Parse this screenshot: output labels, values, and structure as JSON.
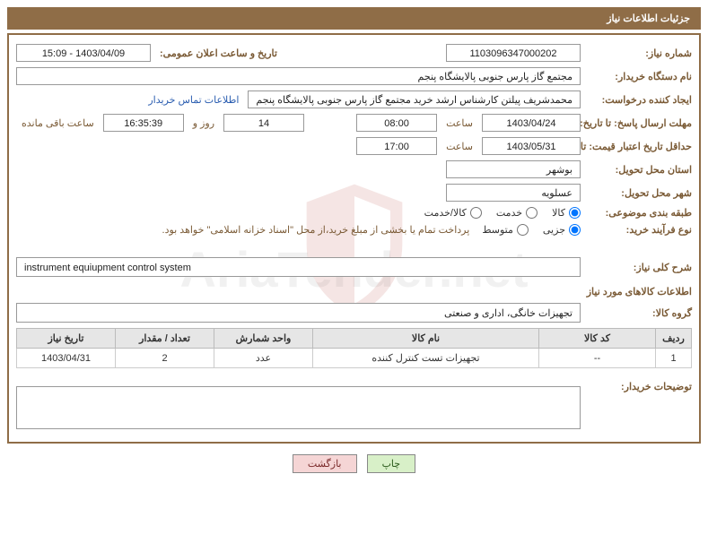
{
  "header": {
    "title": "جزئیات اطلاعات نیاز"
  },
  "labels": {
    "need_no": "شماره نیاز:",
    "announce_datetime": "تاریخ و ساعت اعلان عمومی:",
    "buyer_org": "نام دستگاه خریدار:",
    "requester": "ایجاد کننده درخواست:",
    "buyer_contact": "اطلاعات تماس خریدار",
    "response_deadline": "مهلت ارسال پاسخ: تا تاریخ:",
    "time_word": "ساعت",
    "days_word": "روز و",
    "remaining": "ساعت باقی مانده",
    "validity_deadline": "حداقل تاریخ اعتبار قیمت: تا تاریخ:",
    "delivery_province": "استان محل تحویل:",
    "delivery_city": "شهر محل تحویل:",
    "category": "طبقه بندی موضوعی:",
    "purchase_type": "نوع فرآیند خرید:",
    "general_desc": "شرح کلی نیاز:",
    "goods_section": "اطلاعات کالاهای مورد نیاز",
    "goods_group": "گروه کالا:",
    "buyer_notes": "توضیحات خریدار:"
  },
  "values": {
    "need_no": "1103096347000202",
    "announce_datetime": "1403/04/09 - 15:09",
    "buyer_org": "مجتمع گاز پارس جنوبی  پالایشگاه پنجم",
    "requester": "محمدشریف پیلتن کارشناس ارشد خرید مجتمع گاز پارس جنوبی  پالایشگاه پنجم",
    "response_date": "1403/04/24",
    "response_time": "08:00",
    "remaining_days": "14",
    "remaining_time": "16:35:39",
    "validity_date": "1403/05/31",
    "validity_time": "17:00",
    "delivery_province": "بوشهر",
    "delivery_city": "عسلویه",
    "general_desc": "instrument equiupment control system",
    "goods_group": "تجهیزات خانگی، اداری و صنعتی",
    "purchase_note": "پرداخت تمام یا بخشی از مبلغ خرید،از محل \"اسناد خزانه اسلامی\" خواهد بود."
  },
  "category_options": {
    "goods": "کالا",
    "service": "خدمت",
    "goods_service": "کالا/خدمت"
  },
  "purchase_options": {
    "partial": "جزیی",
    "medium": "متوسط"
  },
  "table": {
    "headers": {
      "idx": "ردیف",
      "code": "کد کالا",
      "name": "نام کالا",
      "unit": "واحد شمارش",
      "qty": "تعداد / مقدار",
      "date": "تاریخ نیاز"
    },
    "rows": [
      {
        "idx": "1",
        "code": "--",
        "name": "تجهیزات تست کنترل کننده",
        "unit": "عدد",
        "qty": "2",
        "date": "1403/04/31"
      }
    ]
  },
  "buttons": {
    "print": "چاپ",
    "back": "بازگشت"
  },
  "watermark": "AriaTender.net"
}
